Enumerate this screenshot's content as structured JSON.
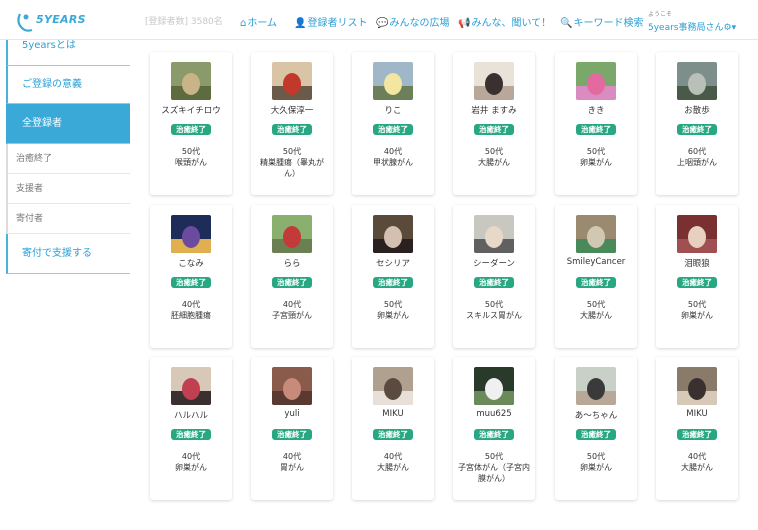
{
  "header": {
    "logo_text": "5YEARS",
    "count_text": "[登録者数] 3580名",
    "nav": [
      {
        "icon": "home-icon",
        "glyph": "⌂",
        "label": "ホーム"
      },
      {
        "icon": "user-icon",
        "glyph": "👤",
        "label": "登録者リスト"
      },
      {
        "icon": "chat-icon",
        "glyph": "💬",
        "label": "みんなの広場"
      },
      {
        "icon": "megaphone-icon",
        "glyph": "📢",
        "label": "みんな、聞いて！"
      },
      {
        "icon": "search-icon",
        "glyph": "🔍",
        "label": "キーワード検索"
      }
    ],
    "welcome": "ようこそ",
    "user_label": "5years事務局さん",
    "gear_glyph": "⚙",
    "caret_glyph": "▾"
  },
  "sidebar": {
    "main_items": [
      {
        "label": "5yearsとは"
      },
      {
        "label": "ご登録の意義"
      },
      {
        "label": "全登録者"
      }
    ],
    "sub_items": [
      {
        "label": "治癒終了"
      },
      {
        "label": "支援者"
      },
      {
        "label": "寄付者"
      }
    ],
    "donate_label": "寄付で支援する"
  },
  "cards": [
    {
      "name": "スズキイチロウ",
      "badge": "治癒終了",
      "age": "50代",
      "cancer": "喉頭がん"
    },
    {
      "name": "大久保淳一",
      "badge": "治癒終了",
      "age": "50代",
      "cancer": "精巣腫瘍（睾丸がん）"
    },
    {
      "name": "りこ",
      "badge": "治癒終了",
      "age": "40代",
      "cancer": "甲状腺がん"
    },
    {
      "name": "岩井 ますみ",
      "badge": "治癒終了",
      "age": "50代",
      "cancer": "大腸がん"
    },
    {
      "name": "きき",
      "badge": "治癒終了",
      "age": "50代",
      "cancer": "卵巣がん"
    },
    {
      "name": "お散歩",
      "badge": "治癒終了",
      "age": "60代",
      "cancer": "上咽頭がん"
    },
    {
      "name": "こなみ",
      "badge": "治癒終了",
      "age": "40代",
      "cancer": "胚細胞腫瘍"
    },
    {
      "name": "らら",
      "badge": "治癒終了",
      "age": "40代",
      "cancer": "子宮頸がん"
    },
    {
      "name": "セシリア",
      "badge": "治癒終了",
      "age": "50代",
      "cancer": "卵巣がん"
    },
    {
      "name": "シーダーン",
      "badge": "治癒終了",
      "age": "50代",
      "cancer": "スキルス胃がん"
    },
    {
      "name": "SmileyCancer",
      "badge": "治癒終了",
      "age": "50代",
      "cancer": "大腸がん"
    },
    {
      "name": "泪眼狼",
      "badge": "治癒終了",
      "age": "50代",
      "cancer": "卵巣がん"
    },
    {
      "name": "ハルハル",
      "badge": "治癒終了",
      "age": "40代",
      "cancer": "卵巣がん"
    },
    {
      "name": "yuli",
      "badge": "治癒終了",
      "age": "40代",
      "cancer": "胃がん"
    },
    {
      "name": "MIKU",
      "badge": "治癒終了",
      "age": "40代",
      "cancer": "大腸がん"
    },
    {
      "name": "muu625",
      "badge": "治癒終了",
      "age": "50代",
      "cancer": "子宮体がん（子宮内膜がん）"
    },
    {
      "name": "あ～ちゃん",
      "badge": "治癒終了",
      "age": "50代",
      "cancer": "卵巣がん"
    },
    {
      "name": "MIKU",
      "badge": "治癒終了",
      "age": "40代",
      "cancer": "大腸がん"
    }
  ],
  "colors": {
    "accent": "#3aa9d8",
    "badge": "#28a882"
  }
}
